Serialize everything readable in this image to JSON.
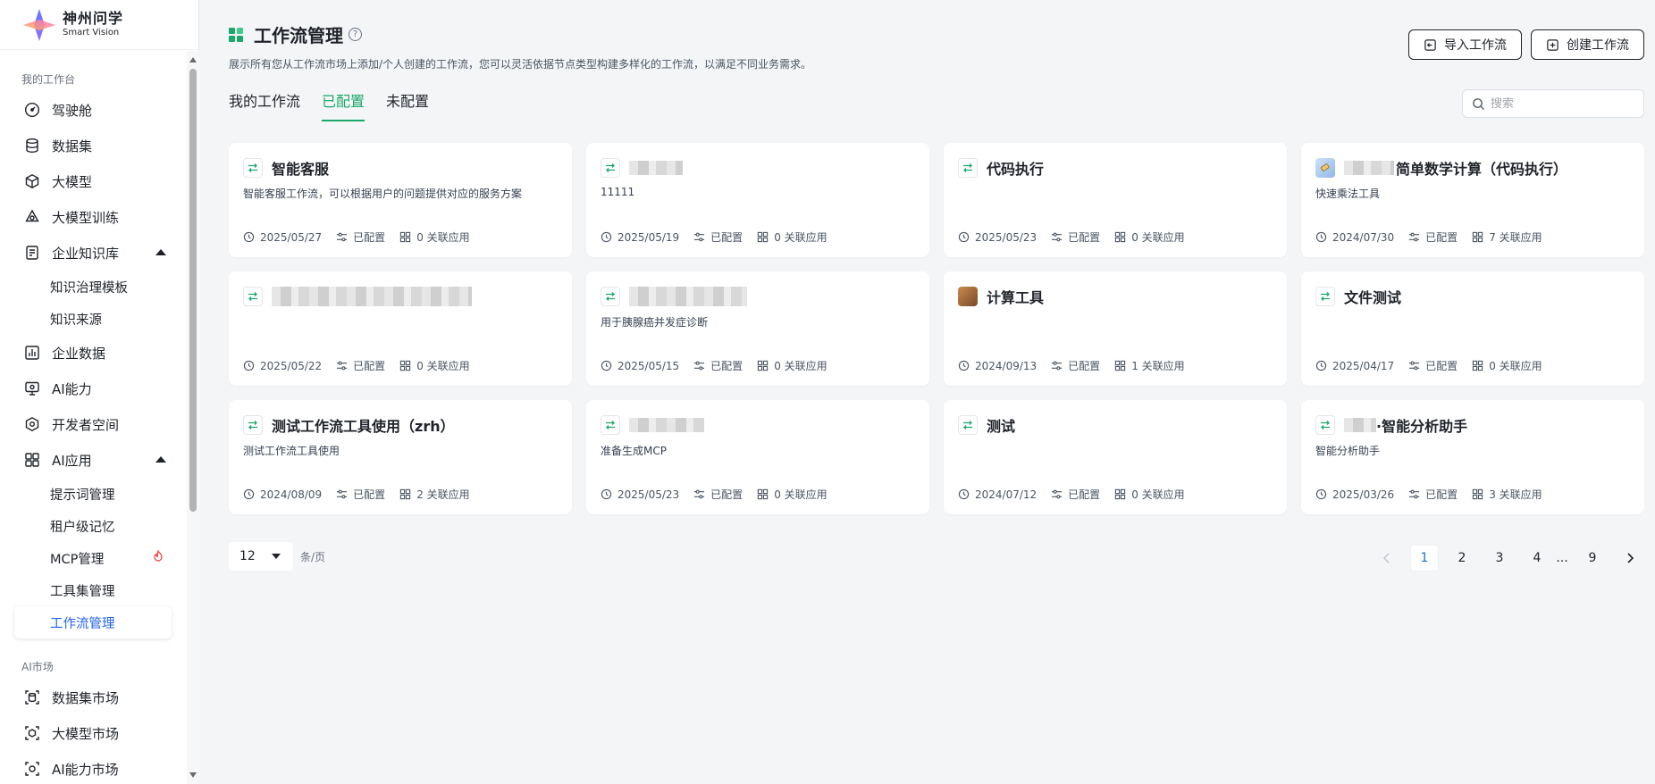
{
  "brand": {
    "name_cn": "神州问学",
    "name_en": "Smart Vision"
  },
  "sidebar": {
    "section_workspace": "我的工作台",
    "items": [
      {
        "label": "驾驶舱",
        "icon": "dashboard-icon"
      },
      {
        "label": "数据集",
        "icon": "database-icon"
      },
      {
        "label": "大模型",
        "icon": "cube-icon"
      },
      {
        "label": "大模型训练",
        "icon": "training-icon"
      },
      {
        "label": "企业知识库",
        "icon": "knowledge-icon"
      },
      {
        "label": "企业数据",
        "icon": "chart-icon"
      },
      {
        "label": "AI能力",
        "icon": "monitor-icon"
      },
      {
        "label": "开发者空间",
        "icon": "developer-icon"
      },
      {
        "label": "AI应用",
        "icon": "apps-icon"
      }
    ],
    "knowledge_sub": [
      "知识治理模板",
      "知识来源"
    ],
    "apps_sub": [
      "提示词管理",
      "租户级记忆",
      "MCP管理",
      "工具集管理",
      "工作流管理"
    ],
    "section_market": "AI市场",
    "market_items": [
      "数据集市场",
      "大模型市场",
      "AI能力市场"
    ]
  },
  "header": {
    "title": "工作流管理",
    "description": "展示所有您从工作流市场上添加/个人创建的工作流，您可以灵活依据节点类型构建多样化的工作流，以满足不同业务需求。",
    "import_label": "导入工作流",
    "create_label": "创建工作流"
  },
  "tabs": [
    "我的工作流",
    "已配置",
    "未配置"
  ],
  "search": {
    "placeholder": "搜索"
  },
  "cards": [
    {
      "title": "智能客服",
      "desc": "智能客服工作流，可以根据用户的问题提供对应的服务方案",
      "date": "2025/05/27",
      "status": "已配置",
      "apps": "0 关联应用"
    },
    {
      "title": "",
      "desc": "11111",
      "date": "2025/05/19",
      "status": "已配置",
      "apps": "0 关联应用"
    },
    {
      "title": "代码执行",
      "desc": "",
      "date": "2025/05/23",
      "status": "已配置",
      "apps": "0 关联应用"
    },
    {
      "title": "简单数学计算（代码执行）",
      "desc": "快速乘法工具",
      "date": "2024/07/30",
      "status": "已配置",
      "apps": "7 关联应用"
    },
    {
      "title": "",
      "desc": "",
      "date": "2025/05/22",
      "status": "已配置",
      "apps": "0 关联应用"
    },
    {
      "title": "",
      "desc": "用于胰腺癌并发症诊断",
      "date": "2025/05/15",
      "status": "已配置",
      "apps": "0 关联应用"
    },
    {
      "title": "计算工具",
      "desc": "",
      "date": "2024/09/13",
      "status": "已配置",
      "apps": "1 关联应用"
    },
    {
      "title": "文件测试",
      "desc": "",
      "date": "2025/04/17",
      "status": "已配置",
      "apps": "0 关联应用"
    },
    {
      "title": "测试工作流工具使用（zrh）",
      "desc": "测试工作流工具使用",
      "date": "2024/08/09",
      "status": "已配置",
      "apps": "2 关联应用"
    },
    {
      "title": "",
      "desc": "准备生成MCP",
      "date": "2025/05/23",
      "status": "已配置",
      "apps": "0 关联应用"
    },
    {
      "title": "测试",
      "desc": "",
      "date": "2024/07/12",
      "status": "已配置",
      "apps": "0 关联应用"
    },
    {
      "title": "·智能分析助手",
      "desc": "智能分析助手",
      "date": "2025/03/26",
      "status": "已配置",
      "apps": "3 关联应用"
    }
  ],
  "pagination": {
    "page_size": "12",
    "per_page": "条/页",
    "pages": [
      "1",
      "2",
      "3",
      "4",
      "...",
      "9"
    ],
    "current": "1"
  },
  "colors": {
    "accent": "#1aa86b",
    "link": "#2563eb"
  }
}
